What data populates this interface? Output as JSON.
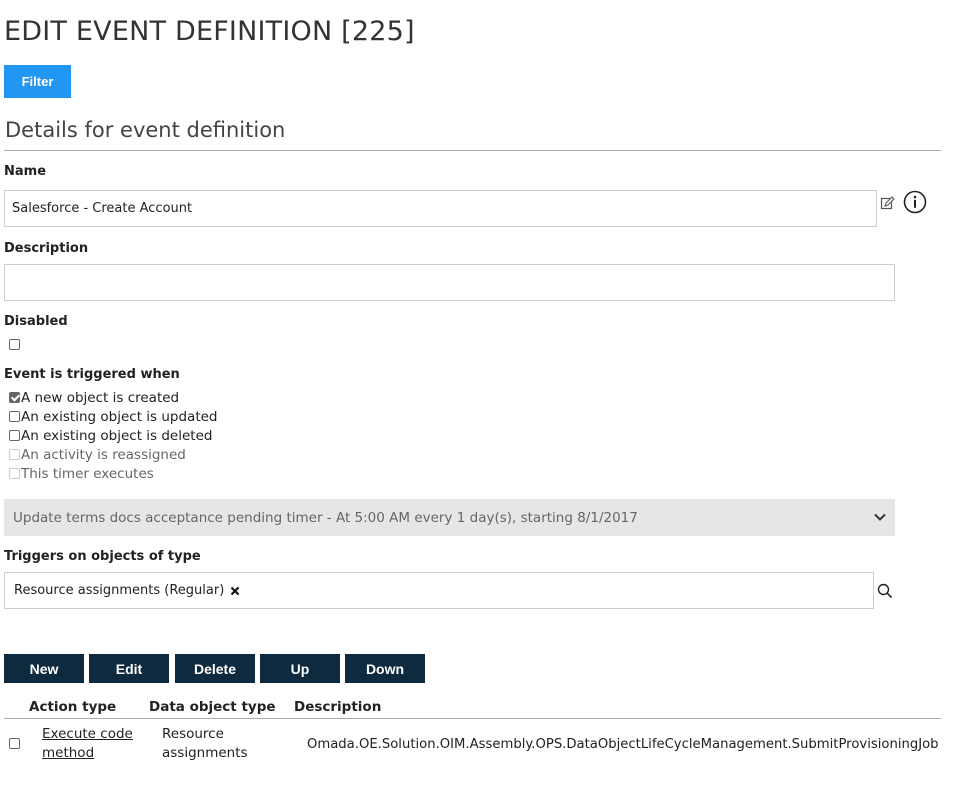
{
  "page": {
    "title": "EDIT EVENT DEFINITION [225]",
    "filter_label": "Filter",
    "section_title": "Details for event definition"
  },
  "form": {
    "name_label": "Name",
    "name_value": "Salesforce - Create Account",
    "description_label": "Description",
    "description_value": "",
    "disabled_label": "Disabled",
    "disabled_checked": false,
    "triggered_label": "Event is triggered when",
    "triggers": [
      {
        "label": "A new object is created",
        "checked": true,
        "enabled": true
      },
      {
        "label": "An existing object is updated",
        "checked": false,
        "enabled": true
      },
      {
        "label": "An existing object is deleted",
        "checked": false,
        "enabled": true
      },
      {
        "label": "An activity is reassigned",
        "checked": false,
        "enabled": false
      },
      {
        "label": "This timer executes",
        "checked": false,
        "enabled": false
      }
    ],
    "timer_value": "Update terms docs acceptance pending timer - At 5:00 AM every 1 day(s), starting 8/1/2017",
    "object_type_label": "Triggers on objects of type",
    "object_type_tag": "Resource assignments (Regular)"
  },
  "toolbar": {
    "new_label": "New",
    "edit_label": "Edit",
    "delete_label": "Delete",
    "up_label": "Up",
    "down_label": "Down"
  },
  "actions_table": {
    "columns": [
      "Action type",
      "Data object type",
      "Description"
    ],
    "rows": [
      {
        "action_type": [
          "Execute code",
          "method"
        ],
        "data_object_type": [
          "Resource",
          "assignments"
        ],
        "description": "Omada.OE.Solution.OIM.Assembly.OPS.DataObjectLifeCycleManagement.SubmitProvisioningJob"
      }
    ]
  },
  "icons": {
    "edit": "edit-icon",
    "info": "info-icon",
    "chevron": "chevron-down-icon",
    "search": "search-icon",
    "remove": "remove-tag-icon"
  },
  "colors": {
    "filter_button": "#2196f3",
    "toolbar_button": "#0e2a3e",
    "disabled_select": "#e6e6e6"
  }
}
